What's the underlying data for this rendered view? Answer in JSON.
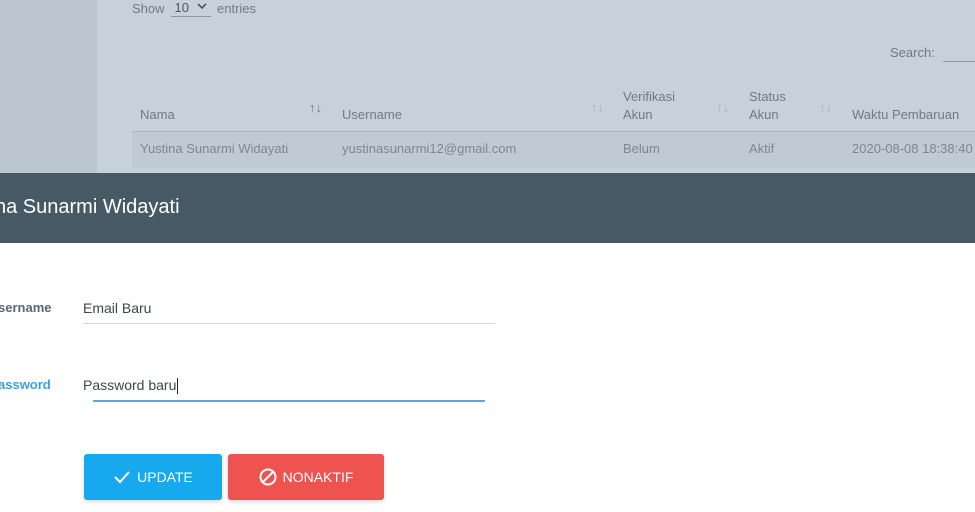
{
  "table_controls": {
    "show_label": "Show",
    "entries_value": "10",
    "entries_label": "entries",
    "search_label": "Search:"
  },
  "table": {
    "columns": [
      "Nama",
      "Username",
      "Verifikasi Akun",
      "Status Akun",
      "Waktu Pembaruan"
    ],
    "rows": [
      [
        "Yustina Sunarmi Widayati",
        "yustinasunarmi12@gmail.com",
        "Belum",
        "Aktif",
        "2020-08-08 18:38:40"
      ]
    ]
  },
  "modal": {
    "title": "na Sunarmi Widayati",
    "fields": {
      "username_label": "sername",
      "username_value": "Email Baru",
      "password_label": "assword",
      "password_value": "Password baru"
    },
    "buttons": {
      "update": "UPDATE",
      "deactivate": "NONAKTIF"
    }
  },
  "colors": {
    "header_bg": "#485966",
    "update_button": "#16a9ee",
    "deactivate_button": "#ef5350",
    "focus_accent": "#3aa0e0"
  }
}
